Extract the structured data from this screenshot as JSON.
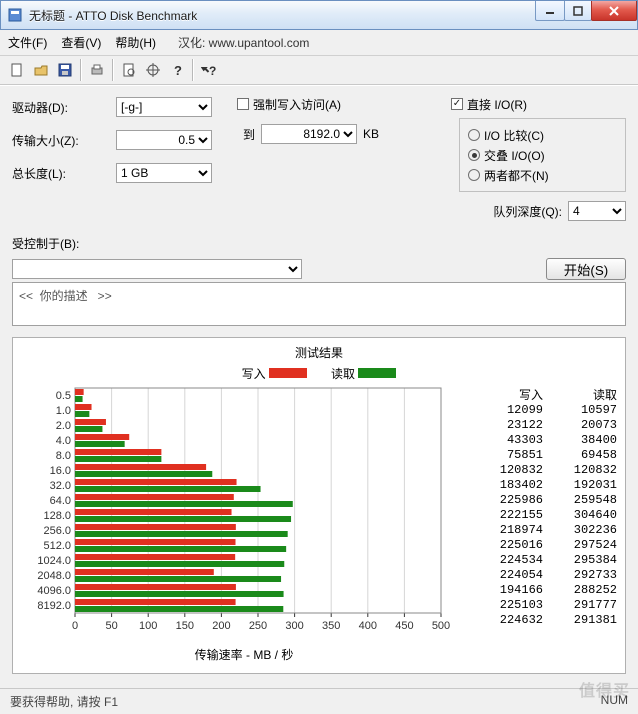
{
  "title": "无标题 - ATTO Disk Benchmark",
  "menu": {
    "file": "文件(F)",
    "view": "查看(V)",
    "help": "帮助(H)",
    "translator": "汉化: www.upantool.com"
  },
  "form": {
    "drive_lbl": "驱动器(D):",
    "drive_val": "[-g-]",
    "xfer_lbl": "传输大小(Z):",
    "xfer_from": "0.5",
    "to_lbl": "到",
    "xfer_to": "8192.0",
    "kb": "KB",
    "len_lbl": "总长度(L):",
    "len_val": "1 GB",
    "force_lbl": "强制写入访问(A)",
    "force_on": false,
    "direct_lbl": "直接 I/O(R)",
    "direct_on": true,
    "radio_cmp": "I/O 比较(C)",
    "radio_ovl": "交叠 I/O(O)",
    "radio_neither": "两者都不(N)",
    "radio_sel": "ovl",
    "qd_lbl": "队列深度(Q):",
    "qd_val": "4",
    "ctrl_lbl": "受控制于(B):",
    "ctrl_val": "",
    "start": "开始(S)",
    "desc": "<<  你的描述   >>"
  },
  "results": {
    "title": "测试结果",
    "legend_write": "写入",
    "legend_read": "读取",
    "col_write": "写入",
    "col_read": "读取",
    "xaxis": "传输速率 - MB / 秒"
  },
  "chart_data": {
    "type": "bar",
    "orientation": "horizontal",
    "categories": [
      "0.5",
      "1.0",
      "2.0",
      "4.0",
      "8.0",
      "16.0",
      "32.0",
      "64.0",
      "128.0",
      "256.0",
      "512.0",
      "1024.0",
      "2048.0",
      "4096.0",
      "8192.0"
    ],
    "series": [
      {
        "name": "写入",
        "color": "#e03020",
        "values_kb": [
          12099,
          23122,
          43303,
          75851,
          120832,
          183402,
          225986,
          222155,
          218974,
          225016,
          224534,
          224054,
          194166,
          225103,
          224632
        ]
      },
      {
        "name": "读取",
        "color": "#1a8a1a",
        "values_kb": [
          10597,
          20073,
          38400,
          69458,
          120832,
          192031,
          259548,
          304640,
          302236,
          297524,
          295384,
          292733,
          288252,
          291777,
          291381
        ]
      }
    ],
    "xlabel": "传输速率 - MB / 秒",
    "xlim": [
      0,
      500
    ],
    "xticks": [
      0,
      50,
      100,
      150,
      200,
      250,
      300,
      350,
      400,
      450,
      500
    ]
  },
  "status": {
    "help": "要获得帮助, 请按 F1",
    "num": "NUM"
  },
  "watermark": "值得买"
}
